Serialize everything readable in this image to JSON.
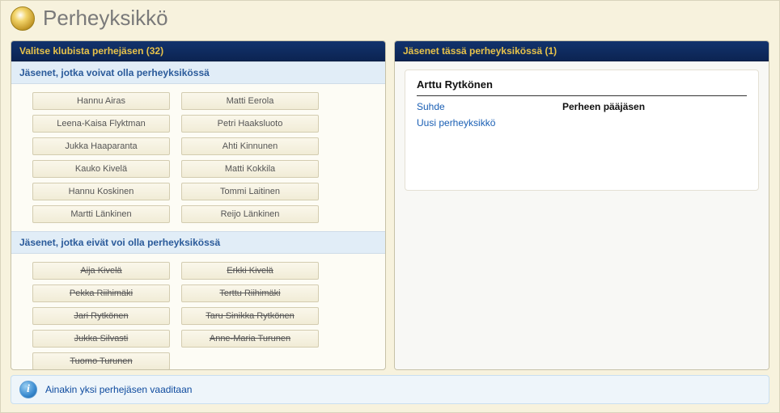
{
  "header": {
    "title": "Perheyksikkö"
  },
  "left_panel": {
    "title": "Valitse klubista perhejäsen (32)",
    "eligible_label": "Jäsenet, jotka voivat olla perheyksikössä",
    "eligible": [
      "Hannu  Airas",
      "Matti  Eerola",
      "Leena-Kaisa  Flyktman",
      "Petri  Haaksluoto",
      "Jukka  Haaparanta",
      "Ahti  Kinnunen",
      "Kauko  Kivelä",
      "Matti  Kokkila",
      "Hannu  Koskinen",
      "Tommi  Laitinen",
      "Martti  Länkinen",
      "Reijo  Länkinen"
    ],
    "ineligible_label": "Jäsenet, jotka eivät voi olla perheyksikössä",
    "ineligible": [
      "Aija  Kivelä",
      "Erkki  Kivelä",
      "Pekka  Riihimäki",
      "Terttu  Riihimäki",
      "Jari  Rytkönen",
      "Taru Sinikka  Rytkönen",
      "Jukka  Silvasti",
      "Anne-Maria  Turunen",
      "Tuomo  Turunen"
    ]
  },
  "right_panel": {
    "title": "Jäsenet tässä perheyksikössä (1)",
    "member_name": "Arttu  Rytkönen",
    "link_relation": "Suhde",
    "link_new_unit": "Uusi perheyksikkö",
    "role": "Perheen pääjäsen"
  },
  "footer": {
    "message": "Ainakin yksi perhejäsen vaaditaan"
  }
}
